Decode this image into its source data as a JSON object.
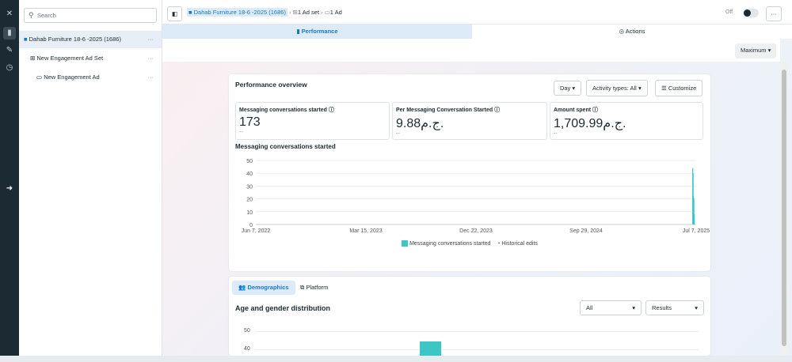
{
  "rail": {
    "icons": [
      "close-icon",
      "chart-icon",
      "pencil-icon",
      "clock-icon",
      "expand-icon"
    ]
  },
  "sidebar": {
    "search_placeholder": "Search",
    "items": [
      {
        "label": "Dahab Furniture 18-6 -2025 (1686)",
        "icon": "folder-icon"
      },
      {
        "label": "New Engagement Ad Set",
        "icon": "adset-icon"
      },
      {
        "label": "New Engagement Ad",
        "icon": "ad-icon"
      }
    ],
    "more": "···"
  },
  "topbar": {
    "breadcrumb": [
      "Dahab Furniture 18-6 -2025 (1686)",
      "1 Ad set",
      "1 Ad"
    ],
    "toggle_label": "Off",
    "more": "···"
  },
  "tabs": [
    {
      "label": "Performance"
    },
    {
      "label": "Actions"
    }
  ],
  "maximum": "Maximum",
  "overview": {
    "title": "Performance overview",
    "day": "Day",
    "activity": "Activity types: All",
    "customize": "Customize",
    "metrics": [
      {
        "label": "Messaging conversations started",
        "value": "173",
        "delta": "--"
      },
      {
        "label": "Per Messaging Conversation Started",
        "value": "9.88ج.م.",
        "delta": "--"
      },
      {
        "label": "Amount spent",
        "value": "1,709.99ج.م.",
        "delta": "--"
      }
    ]
  },
  "chart_data": {
    "type": "bar",
    "title": "Messaging conversations started",
    "ylim": [
      0,
      50
    ],
    "yticks": [
      "0",
      "10",
      "20",
      "30",
      "40",
      "50"
    ],
    "xticks": [
      "Jun 7, 2022",
      "Mar 15, 2023",
      "Dec 22, 2023",
      "Sep 29, 2024",
      "Jul 7, 2025"
    ],
    "x_range_days": [
      0,
      1126
    ],
    "points": [
      {
        "day": 1116,
        "value": 44
      },
      {
        "day": 1117,
        "value": 40
      },
      {
        "day": 1118,
        "value": 22
      },
      {
        "day": 1119,
        "value": 20
      },
      {
        "day": 1120,
        "value": 8
      }
    ],
    "legend": [
      "Messaging conversations started",
      "Historical edits"
    ],
    "color": "#3cc6c6"
  },
  "demographics": {
    "tabs": [
      "Demographics",
      "Platform"
    ],
    "title": "Age and gender distribution",
    "filter": "All",
    "metric": "Results",
    "yticks": [
      "50",
      "40"
    ]
  }
}
